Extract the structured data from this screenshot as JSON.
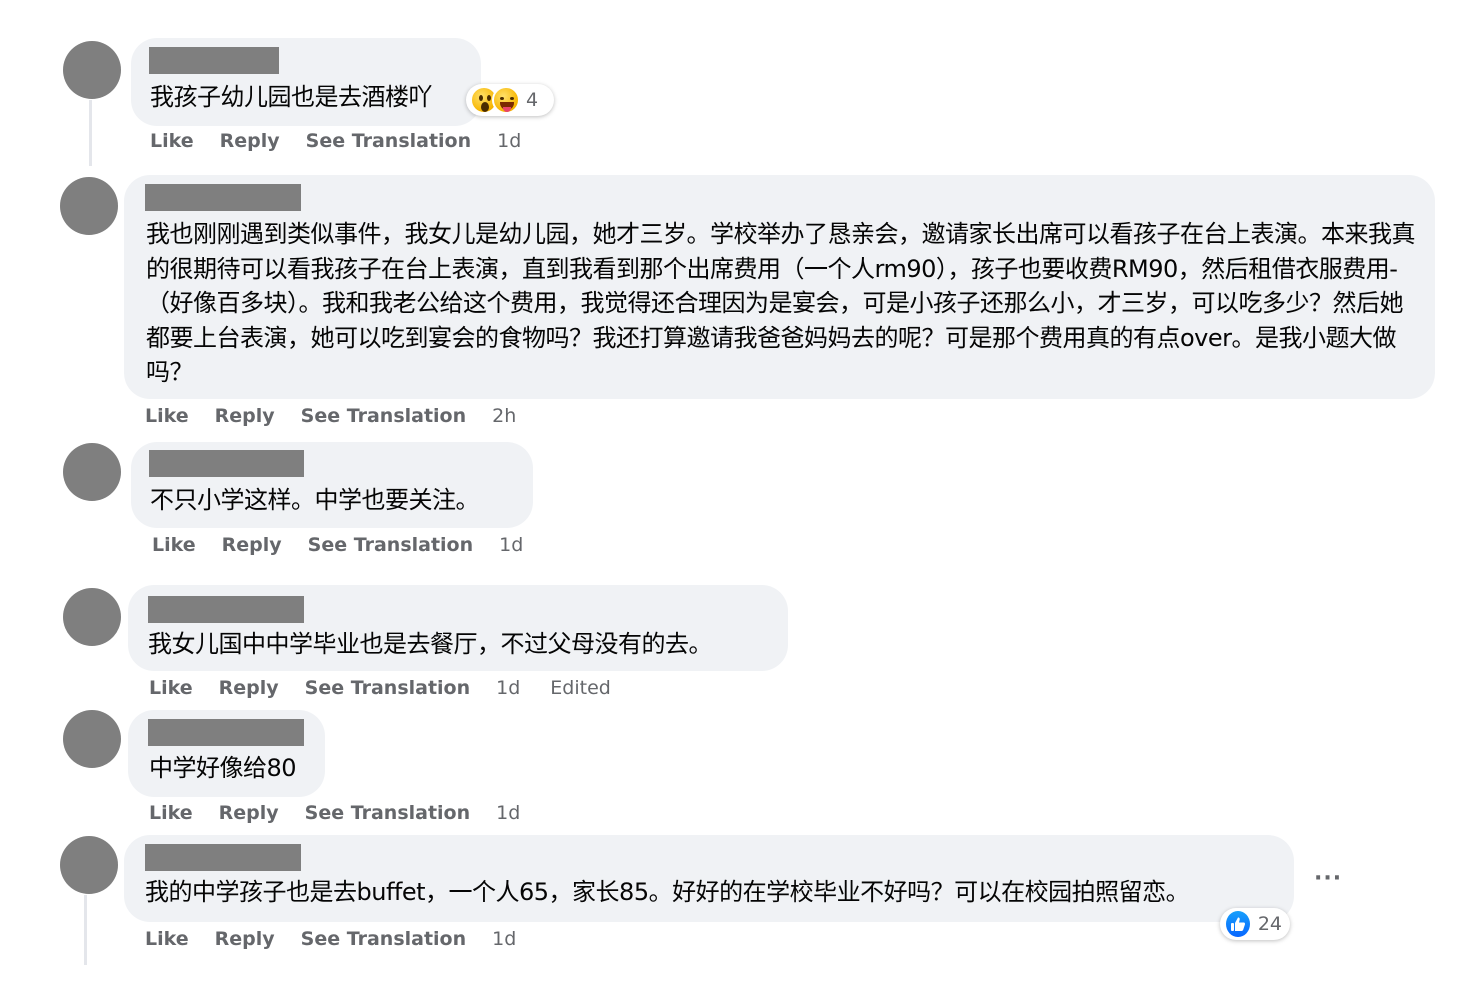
{
  "actions": {
    "like": "Like",
    "reply": "Reply",
    "see_translation": "See Translation"
  },
  "comments": [
    {
      "text": "我孩子幼儿园也是去酒楼吖",
      "time": "1d",
      "reactions": {
        "icons": [
          "surprised-emoji",
          "laughing-emoji"
        ],
        "count": "4"
      }
    },
    {
      "text": "我也刚刚遇到类似事件，我女儿是幼儿园，她才三岁。学校举办了恳亲会，邀请家长出席可以看孩子在台上表演。本来我真的很期待可以看我孩子在台上表演，直到我看到那个出席费用（一个人rm90），孩子也要收费RM90，然后租借衣服费用-（好像百多块）。我和我老公给这个费用，我觉得还合理因为是宴会，可是小孩子还那么小，才三岁，可以吃多少？然后她都要上台表演，她可以吃到宴会的食物吗？我还打算邀请我爸爸妈妈去的呢？可是那个费用真的有点over。是我小题大做吗？",
      "time": "2h"
    },
    {
      "text": "不只小学这样。中学也要关注。",
      "time": "1d"
    },
    {
      "text": "我女儿国中中学毕业也是去餐厅，不过父母没有的去。",
      "time": "1d",
      "edited": "Edited"
    },
    {
      "text": "中学好像给80",
      "time": "1d"
    },
    {
      "text": "我的中学孩子也是去buffet，一个人65，家长85。好好的在学校毕业不好吗？可以在校园拍照留恋。",
      "time": "1d",
      "reactions": {
        "icons": [
          "like-icon"
        ],
        "count": "24"
      },
      "more": "···"
    }
  ],
  "colors": {
    "bubble": "#f0f2f5",
    "action_text": "#65676b",
    "redaction": "#7f7f7f",
    "like_blue": "#0866ff"
  }
}
